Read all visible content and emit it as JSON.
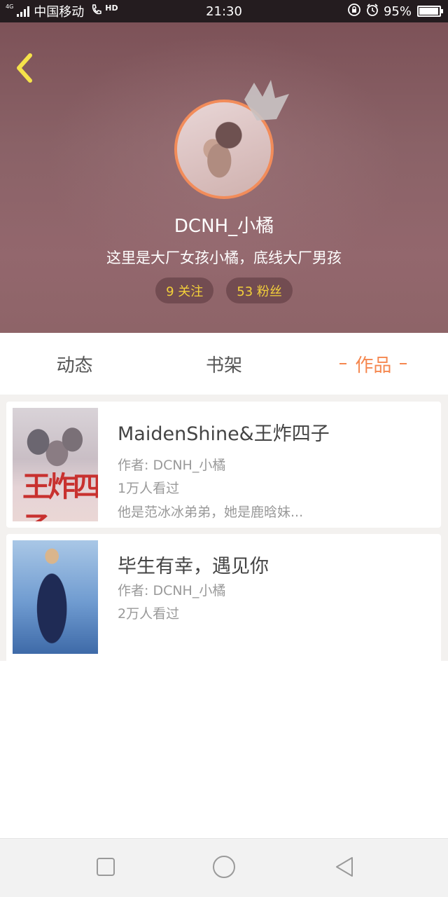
{
  "status_bar": {
    "network_tag": "4G",
    "carrier": "中国移动",
    "hd": "HD",
    "time": "21:30",
    "battery_percent": "95%",
    "battery_level": 0.95
  },
  "profile": {
    "username": "DCNH_小橘",
    "bio": "这里是大厂女孩小橘，底线大厂男孩",
    "following": "9 关注",
    "followers": "53 粉丝"
  },
  "tabs": [
    {
      "label": "动态",
      "active": false
    },
    {
      "label": "书架",
      "active": false
    },
    {
      "label": "作品",
      "active": true
    }
  ],
  "works": [
    {
      "title": "MaidenShine&王炸四子",
      "author": "作者: DCNH_小橘",
      "views": "1万人看过",
      "summary": "他是范冰冰弟弟，她是鹿晗妹...",
      "cover_text": "王炸四子"
    },
    {
      "title": "毕生有幸，遇见你",
      "author": "作者: DCNH_小橘",
      "views": "2万人看过"
    }
  ],
  "icons": {
    "back": "chevron-left-icon",
    "square": "recent-apps-icon",
    "circle": "home-icon",
    "triangle": "back-triangle-icon"
  },
  "colors": {
    "accent": "#f5874f",
    "stat_text": "#f3d03a",
    "header_bg": "#8a6267"
  }
}
